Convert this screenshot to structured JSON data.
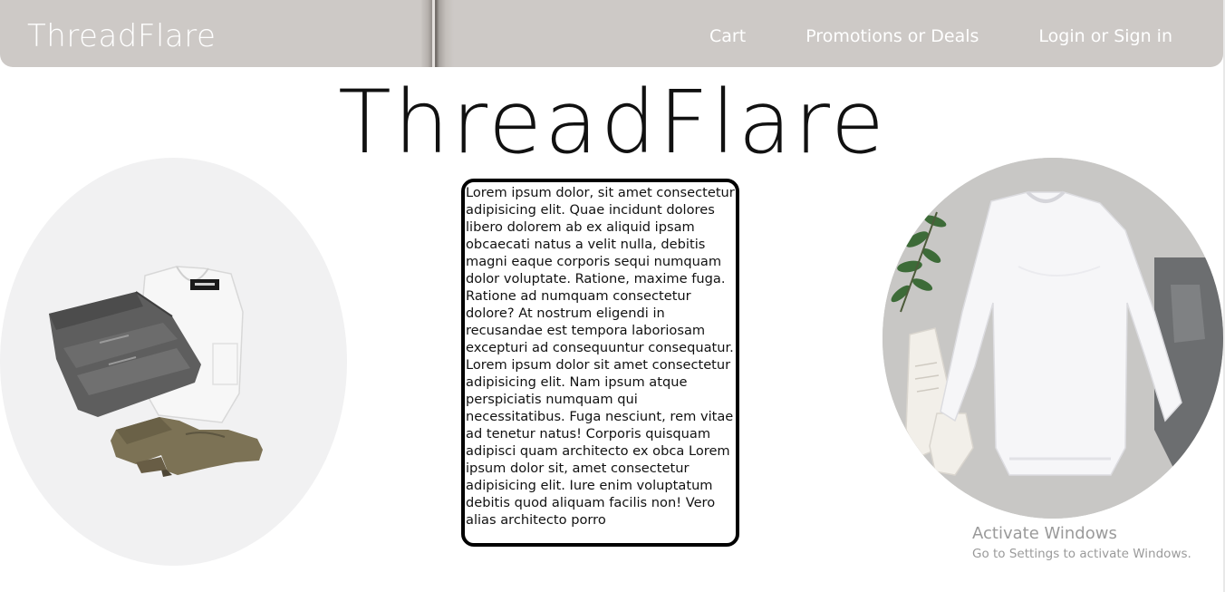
{
  "navbar": {
    "brand": "ThreadFlare",
    "links": [
      {
        "label": "Cart"
      },
      {
        "label": "Promotions or Deals"
      },
      {
        "label": "Login or Sign in"
      }
    ]
  },
  "hero": {
    "title": "ThreadFlare"
  },
  "content": {
    "body_text": "Lorem ipsum dolor, sit amet consectetur adipisicing elit. Quae incidunt dolores libero dolorem ab ex aliquid ipsam obcaecati natus a velit nulla, debitis magni eaque corporis sequi numquam dolor voluptate. Ratione, maxime fuga. Ratione ad numquam consectetur dolore? At nostrum eligendi in recusandae est tempora laboriosam excepturi ad consequuntur consequatur. Lorem ipsum dolor sit amet consectetur adipisicing elit. Nam ipsum atque perspiciatis numquam qui necessitatibus. Fuga nesciunt, rem vitae ad tenetur natus! Corporis quisquam adipisci quam architecto ex obca Lorem ipsum dolor sit, amet consectetur adipisicing elit. Iure enim voluptatum debitis quod aliquam facilis non! Vero alias architecto porro"
  },
  "watermark": {
    "title": "Activate Windows",
    "subtitle": "Go to Settings to activate Windows."
  },
  "colors": {
    "navbar_bg": "#cdc9c6",
    "nav_text": "#ffffff",
    "title_text": "#111111",
    "box_border": "#000000"
  }
}
